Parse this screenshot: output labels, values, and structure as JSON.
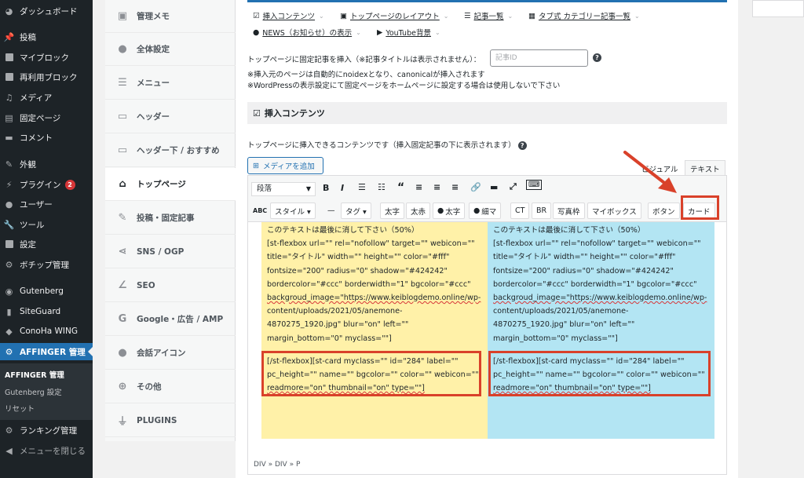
{
  "adminmenu": {
    "items": [
      {
        "label": "ダッシュボード",
        "icon": "dashboard-icon"
      },
      {
        "label": "投稿",
        "icon": "pin-icon"
      },
      {
        "label": "マイブロック",
        "icon": "grid-icon"
      },
      {
        "label": "再利用ブロック",
        "icon": "grid-icon"
      },
      {
        "label": "メディア",
        "icon": "media-icon"
      },
      {
        "label": "固定ページ",
        "icon": "page-icon"
      },
      {
        "label": "コメント",
        "icon": "comment-icon"
      },
      {
        "label": "外観",
        "icon": "brush-icon"
      },
      {
        "label": "プラグイン",
        "icon": "plug-icon",
        "badge": "2"
      },
      {
        "label": "ユーザー",
        "icon": "user-icon"
      },
      {
        "label": "ツール",
        "icon": "wrench-icon"
      },
      {
        "label": "設定",
        "icon": "settings-icon"
      },
      {
        "label": "ボチップ管理",
        "icon": "gear-icon"
      },
      {
        "label": "Gutenberg",
        "icon": "gutenberg-icon"
      },
      {
        "label": "SiteGuard",
        "icon": "shield-icon"
      },
      {
        "label": "ConoHa WING",
        "icon": "conoha-icon"
      },
      {
        "label": "AFFINGER 管理",
        "icon": "gear-icon"
      },
      {
        "label": "ランキング管理",
        "icon": "gear-icon"
      },
      {
        "label": "メニューを閉じる",
        "icon": "collapse-icon"
      }
    ],
    "submenu": [
      "AFFINGER 管理",
      "Gutenberg 設定",
      "リセット"
    ]
  },
  "tabnav": {
    "items": [
      "管理メモ",
      "全体設定",
      "メニュー",
      "ヘッダー",
      "ヘッダー下 / おすすめ",
      "トップページ",
      "投稿・固定記事",
      "SNS / OGP",
      "SEO",
      "Google・広告 / AMP",
      "会話アイコン",
      "その他",
      "PLUGINS"
    ]
  },
  "links": {
    "row1": [
      "挿入コンテンツ",
      "トップページのレイアウト",
      "記事一覧",
      "タブ式 カテゴリー記事一覧"
    ],
    "row2": [
      "NEWS（お知らせ）の表示",
      "YouTube背景"
    ]
  },
  "fixed": {
    "label": "トップページに固定記事を挿入（※記事タイトルは表示されません）：",
    "placeholder": "記事ID",
    "note1": "※挿入元のページは自動的にnoidexとなり、canonicalが挿入されます",
    "note2": "※WordPressの表示設定にて固定ページをホームページに設定する場合は使用しないで下さい"
  },
  "section": {
    "title": "挿入コンテンツ",
    "desc": "トップページに挿入できるコンテンツです（挿入固定記事の下に表示されます）"
  },
  "editor": {
    "media_button": "メディアを追加",
    "tab_visual": "ビジュアル",
    "tab_text": "テキスト",
    "format": "段落",
    "buttons2": [
      "スタイル ▾",
      "—",
      "タグ ▾",
      "太字",
      "太赤",
      "太字",
      "細マ",
      "CT",
      "BR",
      "写真枠",
      "マイボックス",
      "ボタン",
      "カード"
    ],
    "status": "DIV » DIV » P",
    "columns": {
      "heading": "このテキストは最後に消して下さい（50%）",
      "lines": [
        "[st-flexbox url=\"\" rel=\"nofollow\" target=\"\" webicon=\"\"",
        "title=\"タイトル\" width=\"\" height=\"\" color=\"#fff\"",
        "fontsize=\"200\" radius=\"0\" shadow=\"#424242\"",
        "bordercolor=\"#ccc\" borderwidth=\"1\" bgcolor=\"#ccc\"",
        "backgroud_image=\"https://www.keiblogdemo.online/wp-",
        "content/uploads/2021/05/anemone-",
        "4870275_1920.jpg\" blur=\"on\" left=\"\"",
        "margin_bottom=\"0\" myclass=\"\"]"
      ],
      "card_lines": [
        "[/st-flexbox][st-card myclass=\"\" id=\"284\" label=\"\"",
        "pc_height=\"\" name=\"\" bgcolor=\"\" color=\"\" webicon=\"\"",
        "readmore=\"on\" thumbnail=\"on\" type=\"\"]"
      ]
    }
  },
  "colors": {
    "accent": "#2271b1",
    "annotation": "#d9412a",
    "left_col": "#fff1a8",
    "right_col": "#b3e5f3"
  }
}
